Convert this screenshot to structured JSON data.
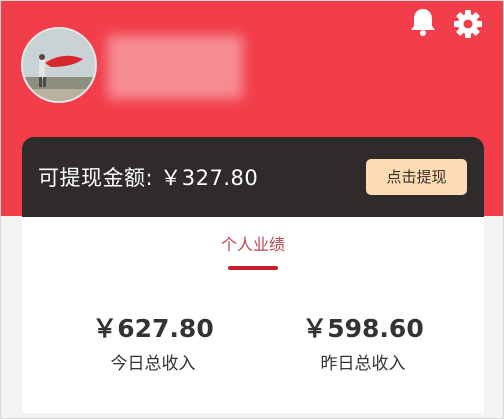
{
  "header": {
    "notifications_icon": "bell-icon",
    "settings_icon": "gear-icon",
    "background_color": "#f23d4a"
  },
  "balance": {
    "label": "可提现金额: ￥327.80",
    "withdraw_button": "点击提现"
  },
  "performance": {
    "tab_label": "个人业绩",
    "accent_color": "#c81d2b",
    "stats": [
      {
        "value": "￥627.80",
        "label": "今日总收入"
      },
      {
        "value": "￥598.60",
        "label": "昨日总收入"
      }
    ]
  }
}
